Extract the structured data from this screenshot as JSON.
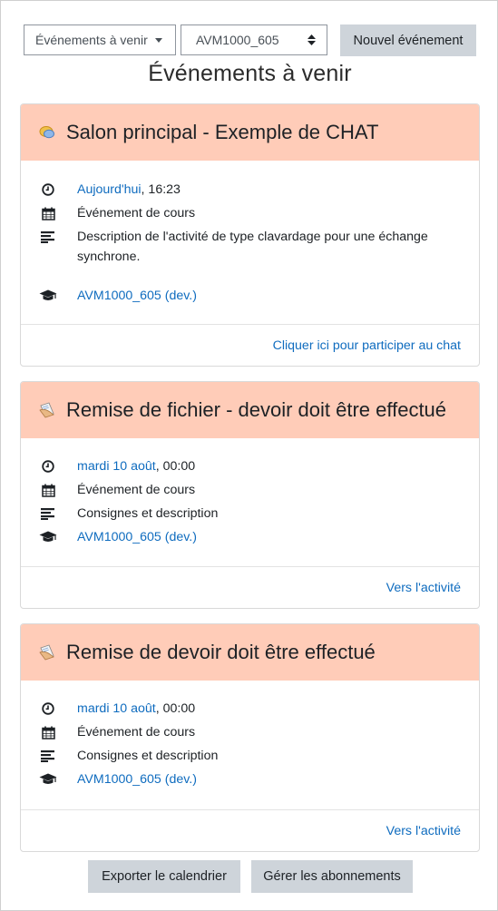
{
  "toolbar": {
    "view_select": "Événements à venir",
    "course_select": "AVM1000_605",
    "new_event": "Nouvel événement"
  },
  "page_title": "Événements à venir",
  "events": [
    {
      "title": "Salon principal - Exemple de CHAT",
      "date_link": "Aujourd'hui",
      "time": ", 16:23",
      "type": "Événement de cours",
      "description": "Description de l'activité de type clavardage pour une échange synchrone.",
      "course": "AVM1000_605 (dev.)",
      "action": "Cliquer ici pour participer au chat"
    },
    {
      "title": "Remise de fichier - devoir doit être effectué",
      "date_link": "mardi 10 août",
      "time": ", 00:00",
      "type": "Événement de cours",
      "description": "Consignes et description",
      "course": "AVM1000_605 (dev.)",
      "action": "Vers l'activité"
    },
    {
      "title": "Remise de devoir doit être effectué",
      "date_link": "mardi 10 août",
      "time": ", 00:00",
      "type": "Événement de cours",
      "description": "Consignes et description",
      "course": "AVM1000_605 (dev.)",
      "action": "Vers l'activité"
    }
  ],
  "footer": {
    "export": "Exporter le calendrier",
    "manage": "Gérer les abonnements"
  },
  "colors": {
    "header_bg": "#ffccb8",
    "link": "#0f6cbf",
    "button_grey": "#ced4da"
  }
}
